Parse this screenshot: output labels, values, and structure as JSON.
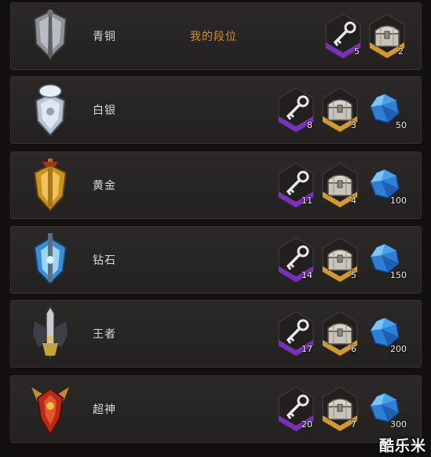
{
  "my_rank_label": "我的段位",
  "watermark": "酷乐米",
  "tiers": [
    {
      "name": "青铜",
      "emblem": "bronze-emblem-icon",
      "rewards": [
        {
          "type": "key",
          "count": "5"
        },
        {
          "type": "chest",
          "count": "2"
        }
      ],
      "my_rank": true
    },
    {
      "name": "白银",
      "emblem": "silver-emblem-icon",
      "rewards": [
        {
          "type": "key",
          "count": "8"
        },
        {
          "type": "chest",
          "count": "3"
        },
        {
          "type": "gem",
          "count": "50"
        }
      ]
    },
    {
      "name": "黄金",
      "emblem": "gold-emblem-icon",
      "rewards": [
        {
          "type": "key",
          "count": "11"
        },
        {
          "type": "chest",
          "count": "4"
        },
        {
          "type": "gem",
          "count": "100"
        }
      ]
    },
    {
      "name": "钻石",
      "emblem": "diamond-emblem-icon",
      "rewards": [
        {
          "type": "key",
          "count": "14"
        },
        {
          "type": "chest",
          "count": "5"
        },
        {
          "type": "gem",
          "count": "150"
        }
      ]
    },
    {
      "name": "王者",
      "emblem": "king-emblem-icon",
      "rewards": [
        {
          "type": "key",
          "count": "17"
        },
        {
          "type": "chest",
          "count": "6"
        },
        {
          "type": "gem",
          "count": "200"
        }
      ]
    },
    {
      "name": "超神",
      "emblem": "godlike-emblem-icon",
      "rewards": [
        {
          "type": "key",
          "count": "20"
        },
        {
          "type": "chest",
          "count": "7"
        },
        {
          "type": "gem",
          "count": "300"
        }
      ]
    }
  ],
  "colors": {
    "bronze": "#9a9ea2",
    "silver": "#c9d3dc",
    "gold": "#d9a526",
    "diamond": "#57a9e6",
    "king": "#8c8f96",
    "godlike": "#c4301f",
    "key_frame": "#7b2fc0",
    "chest_frame": "#d29a2c",
    "my_rank": "#d28f2c"
  }
}
